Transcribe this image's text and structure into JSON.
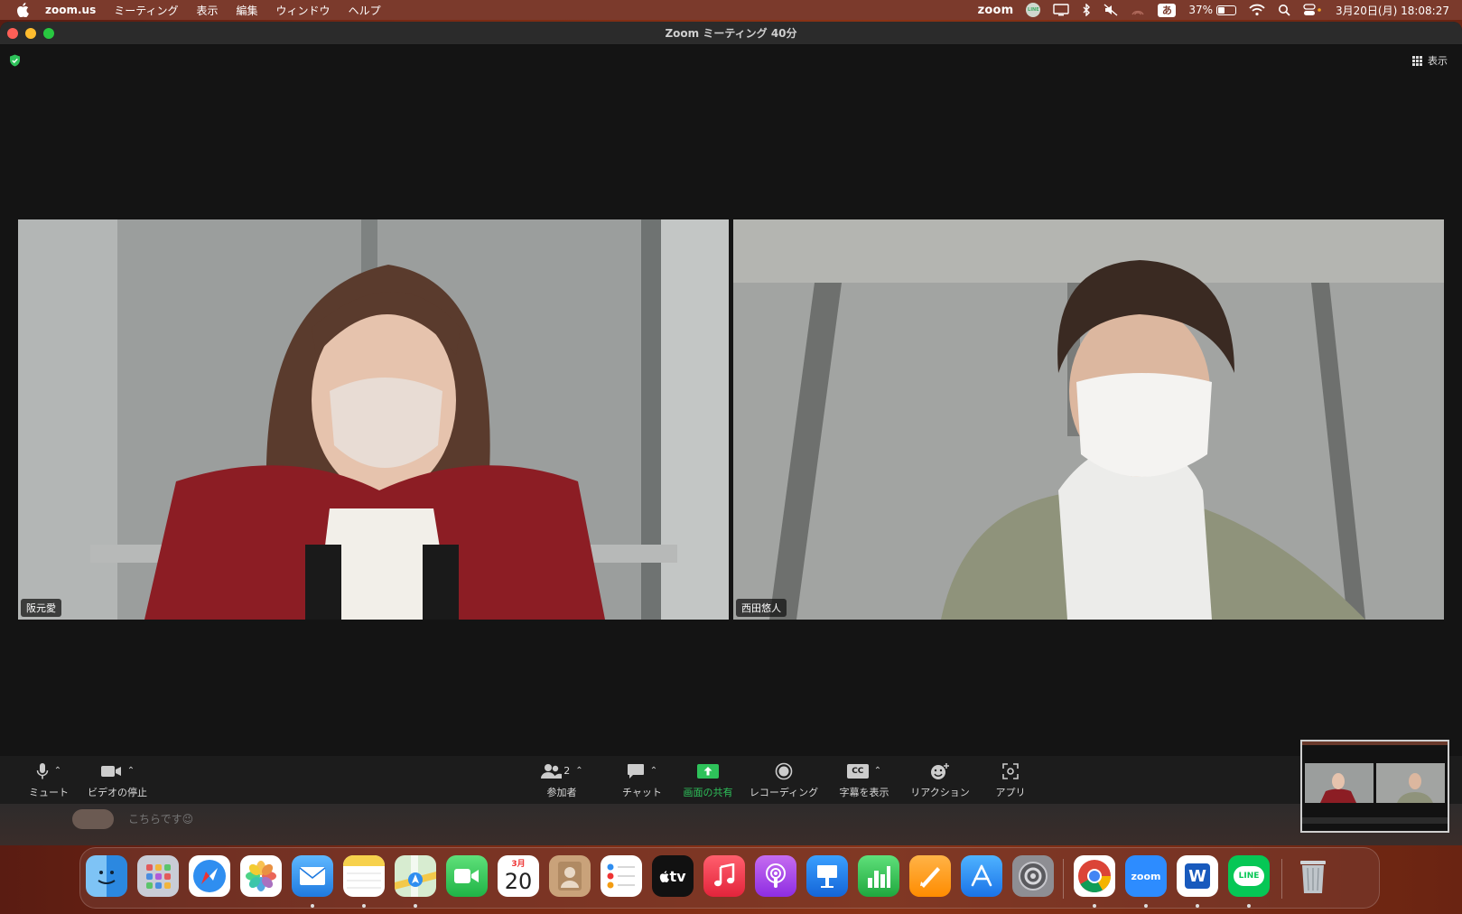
{
  "menubar": {
    "app": "zoom.us",
    "items": [
      "ミーティング",
      "表示",
      "編集",
      "ウィンドウ",
      "ヘルプ"
    ],
    "zoom_word": "zoom",
    "line_badge": "LINE",
    "ime": "あ",
    "battery": "37%",
    "battery_level": 0.37,
    "datetime": "3月20日(月)  18:08:27"
  },
  "window": {
    "title": "Zoom ミーティング   40分",
    "view_label": "表示"
  },
  "participants": [
    {
      "name": "阪元愛"
    },
    {
      "name": "西田悠人"
    }
  ],
  "toolbar": {
    "mute": "ミュート",
    "video": "ビデオの停止",
    "participants": "参加者",
    "participant_count": "2",
    "chat": "チャット",
    "share": "画面の共有",
    "record": "レコーディング",
    "captions": "字幕を表示",
    "captions_badge": "CC",
    "reactions": "リアクション",
    "apps": "アプリ"
  },
  "background": {
    "message": "こちらです😉"
  },
  "dock": {
    "calendar_month": "3月",
    "calendar_day": "20",
    "tv_label": "tv",
    "zoom_label": "zoom",
    "word_label": "W",
    "line_label": "LINE"
  },
  "colors": {
    "accent_green": "#2ec25a",
    "window_bg": "#141414",
    "toolbar_bg": "#1c1c1c"
  }
}
